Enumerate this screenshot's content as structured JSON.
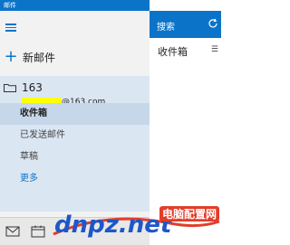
{
  "app": {
    "title": "邮件"
  },
  "nav": {
    "new_mail_label": "新邮件"
  },
  "account": {
    "name": "163",
    "email_suffix": "@163.com"
  },
  "folders": [
    {
      "label": "收件箱",
      "selected": true
    },
    {
      "label": "已发送邮件",
      "selected": false
    },
    {
      "label": "草稿",
      "selected": false
    },
    {
      "label": "更多",
      "selected": false
    }
  ],
  "search": {
    "label": "搜索"
  },
  "message_list": {
    "heading": "收件箱"
  },
  "watermark": {
    "text": "dnpz.net",
    "site": "电脑配置网"
  },
  "colors": {
    "accent": "#0b74c9",
    "selected": "#c6d7ea",
    "account_bg": "#dbe6f3"
  }
}
